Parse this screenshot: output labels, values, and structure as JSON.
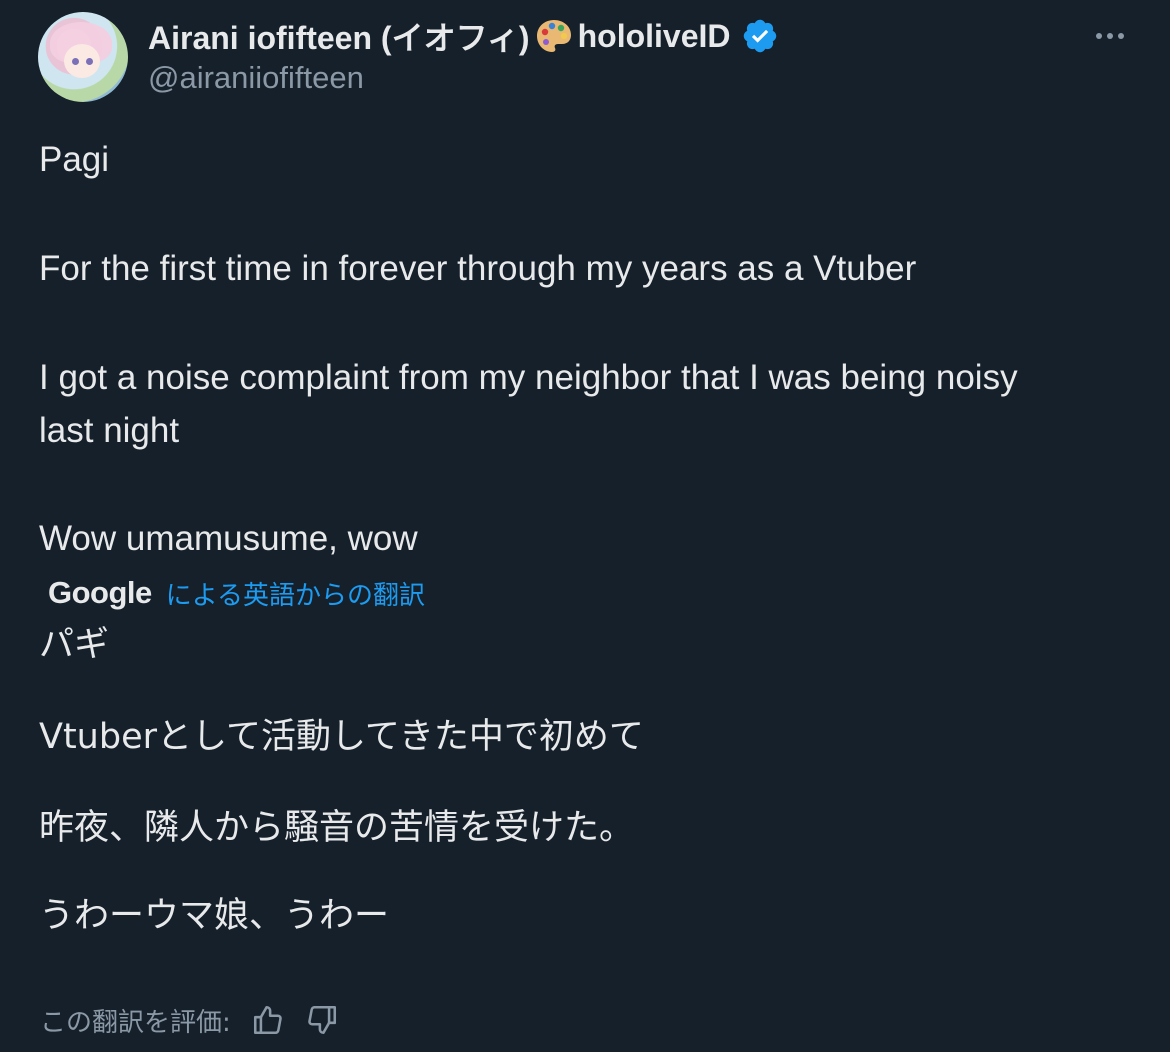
{
  "author": {
    "display_name": "Airani iofifteen (イオフィ)",
    "display_suffix": "hololiveID",
    "handle": "@airaniiofifteen"
  },
  "tweet": {
    "lines": [
      "Pagi",
      "For the first time in forever through my years as a Vtuber",
      "I got a noise complaint from my neighbor that I was being noisy",
      "last night",
      "Wow umamusume, wow"
    ]
  },
  "translation": {
    "provider": "Google",
    "label": "による英語からの翻訳",
    "lines": [
      "パギ",
      "Vtuberとして活動してきた中で初めて",
      "昨夜、隣人から騒音の苦情を受けた。",
      "うわーウマ娘、うわー"
    ],
    "rate_label": "この翻訳を評価:"
  },
  "icons": {
    "palette": "palette-icon",
    "verified": "verified-badge-icon",
    "more": "more-options-icon",
    "thumbs_up": "thumbs-up-icon",
    "thumbs_down": "thumbs-down-icon"
  },
  "colors": {
    "background": "#15202b",
    "text": "#e7e9ea",
    "secondary": "#8b98a5",
    "link": "#1d9bf0",
    "verified": "#1d9bf0"
  }
}
